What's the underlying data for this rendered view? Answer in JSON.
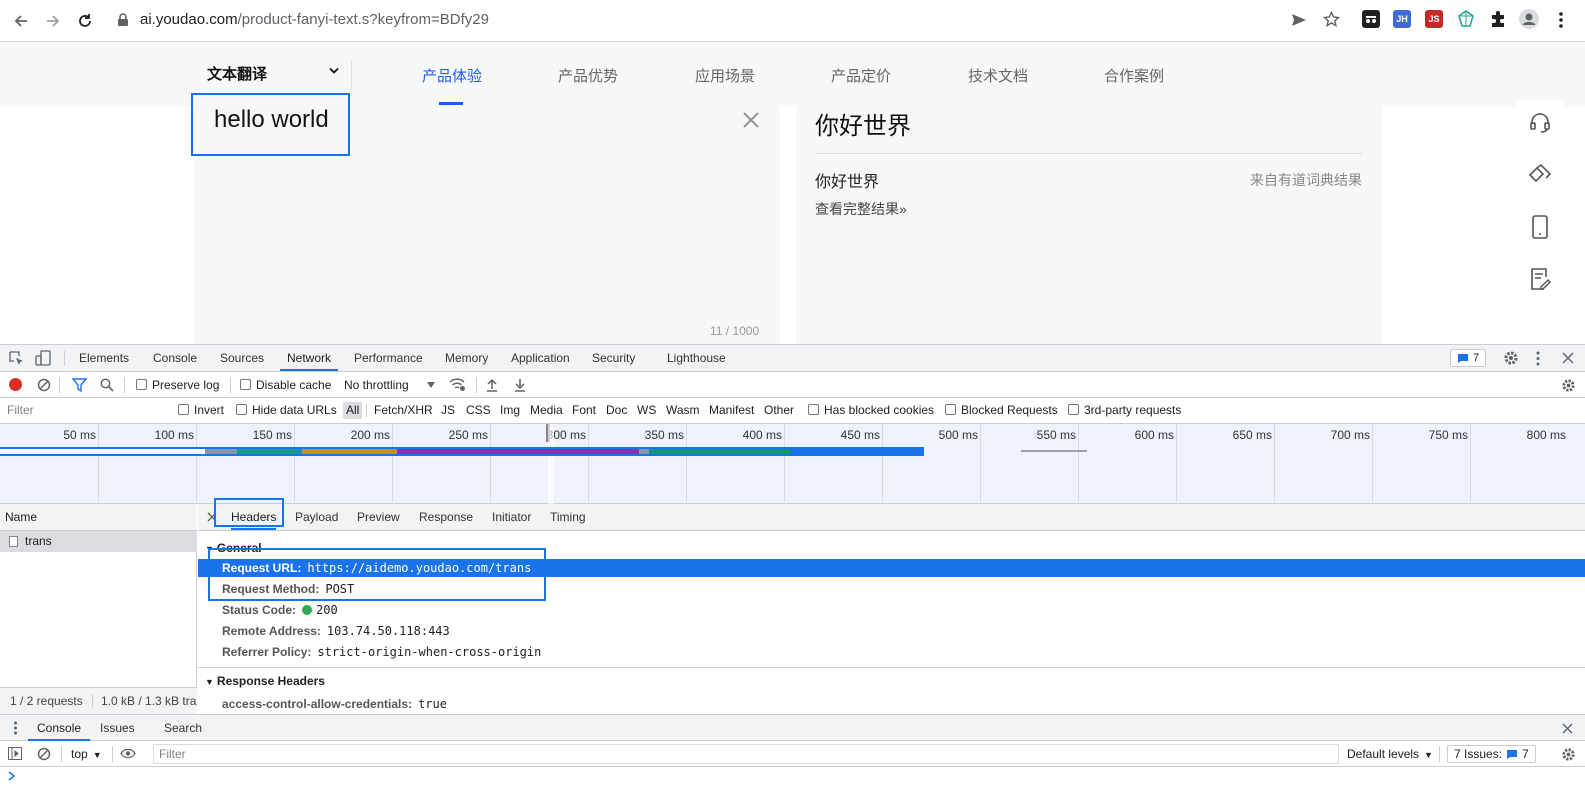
{
  "browser": {
    "url_domain": "ai.youdao.com",
    "url_path": "/product-fanyi-text.s?keyfrom=BDfy29",
    "extensions": {
      "jh": "JH",
      "js": "JS"
    }
  },
  "site": {
    "product_select": "文本翻译",
    "nav": [
      "产品体验",
      "产品优势",
      "应用场景",
      "产品定价",
      "技术文档",
      "合作案例"
    ],
    "source_text": "hello world",
    "char_count": "11 / 1000",
    "translation": "你好世界",
    "dict_result": "你好世界",
    "dict_source": "来自有道词典结果",
    "view_full": "查看完整结果»"
  },
  "devtools": {
    "tabs": [
      "Elements",
      "Console",
      "Sources",
      "Network",
      "Performance",
      "Memory",
      "Application",
      "Security",
      "Lighthouse"
    ],
    "issues_badge": "7",
    "toolbar": {
      "preserve_log": "Preserve log",
      "disable_cache": "Disable cache",
      "throttling": "No throttling"
    },
    "filter": {
      "placeholder": "Filter",
      "invert": "Invert",
      "hide_data_urls": "Hide data URLs",
      "types": [
        "All",
        "Fetch/XHR",
        "JS",
        "CSS",
        "Img",
        "Media",
        "Font",
        "Doc",
        "WS",
        "Wasm",
        "Manifest",
        "Other"
      ],
      "has_blocked_cookies": "Has blocked cookies",
      "blocked_requests": "Blocked Requests",
      "third_party": "3rd-party requests"
    },
    "timeline_ticks": [
      "50 ms",
      "100 ms",
      "150 ms",
      "200 ms",
      "250 ms",
      "300 ms",
      "350 ms",
      "400 ms",
      "450 ms",
      "500 ms",
      "550 ms",
      "600 ms",
      "650 ms",
      "700 ms",
      "750 ms",
      "800 ms"
    ],
    "requests": {
      "column_name": "Name",
      "items": [
        "trans"
      ],
      "summary_count": "1 / 2 requests",
      "summary_size": "1.0 kB / 1.3 kB tra"
    },
    "detail_tabs": [
      "Headers",
      "Payload",
      "Preview",
      "Response",
      "Initiator",
      "Timing"
    ],
    "general": {
      "title": "General",
      "rows": [
        {
          "key": "Request URL:",
          "value": "https://aidemo.youdao.com/trans"
        },
        {
          "key": "Request Method:",
          "value": "POST"
        },
        {
          "key": "Status Code:",
          "value": "200"
        },
        {
          "key": "Remote Address:",
          "value": "103.74.50.118:443"
        },
        {
          "key": "Referrer Policy:",
          "value": "strict-origin-when-cross-origin"
        }
      ]
    },
    "response_headers": {
      "title": "Response Headers",
      "rows": [
        {
          "key": "access-control-allow-credentials:",
          "value": "true"
        }
      ]
    },
    "drawer": {
      "tabs": [
        "Console",
        "Issues",
        "Search"
      ],
      "context": "top",
      "filter_placeholder": "Filter",
      "levels": "Default levels",
      "issues": "7 Issues:",
      "issues_count": "7"
    }
  }
}
